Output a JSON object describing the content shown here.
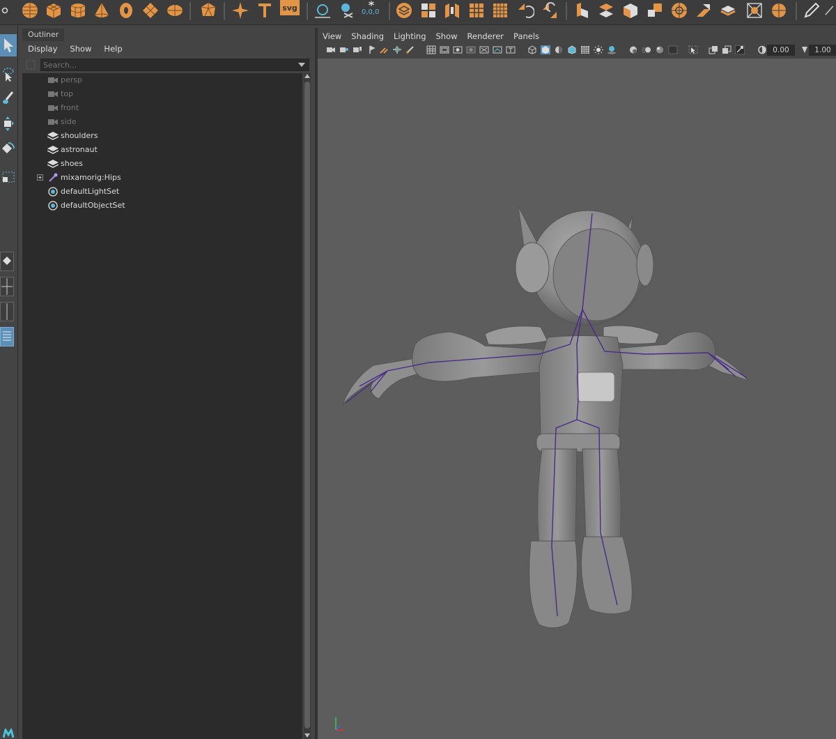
{
  "shelf": {
    "icons": [
      "sphere-icon",
      "cube-icon",
      "cylinder-icon",
      "cone-icon",
      "torus-icon",
      "plane-icon",
      "disc-icon",
      "platonic-icon",
      "sweep-icon",
      "type-icon",
      "svg-icon",
      "measure-icon",
      "snap-icon",
      "freeze-icon",
      "combine-icon",
      "separate-icon",
      "extract-icon",
      "smooth-icon",
      "boolean-icon",
      "mirror-icon",
      "bridge-icon",
      "extrude-icon",
      "bevel-icon",
      "multicut-icon",
      "target-weld-icon",
      "append-icon",
      "fill-hole-icon",
      "merge-icon",
      "pencil-icon"
    ],
    "svg_label": "svg",
    "snap_readout": "0,0,0",
    "accent_color": "#e39547"
  },
  "outliner": {
    "tab_label": "Outliner",
    "menus": [
      "Display",
      "Show",
      "Help"
    ],
    "search_placeholder": "Search...",
    "items": [
      {
        "label": "persp",
        "icon": "camera-icon",
        "dim": true
      },
      {
        "label": "top",
        "icon": "camera-icon",
        "dim": true
      },
      {
        "label": "front",
        "icon": "camera-icon",
        "dim": true
      },
      {
        "label": "side",
        "icon": "camera-icon",
        "dim": true
      },
      {
        "label": "shoulders",
        "icon": "mesh-icon",
        "dim": false
      },
      {
        "label": "astronaut",
        "icon": "mesh-icon",
        "dim": false
      },
      {
        "label": "shoes",
        "icon": "mesh-icon",
        "dim": false
      },
      {
        "label": "mixamorig:Hips",
        "icon": "joint-icon",
        "dim": false,
        "expandable": true
      },
      {
        "label": "defaultLightSet",
        "icon": "set-icon",
        "dim": false
      },
      {
        "label": "defaultObjectSet",
        "icon": "set-icon",
        "dim": false
      }
    ]
  },
  "viewport": {
    "menus": [
      "View",
      "Shading",
      "Lighting",
      "Show",
      "Renderer",
      "Panels"
    ],
    "exposure_value": "0.00",
    "gamma_value": "1.00",
    "background_color": "#5d5d5d",
    "skeleton_color": "#4a2a8a"
  }
}
